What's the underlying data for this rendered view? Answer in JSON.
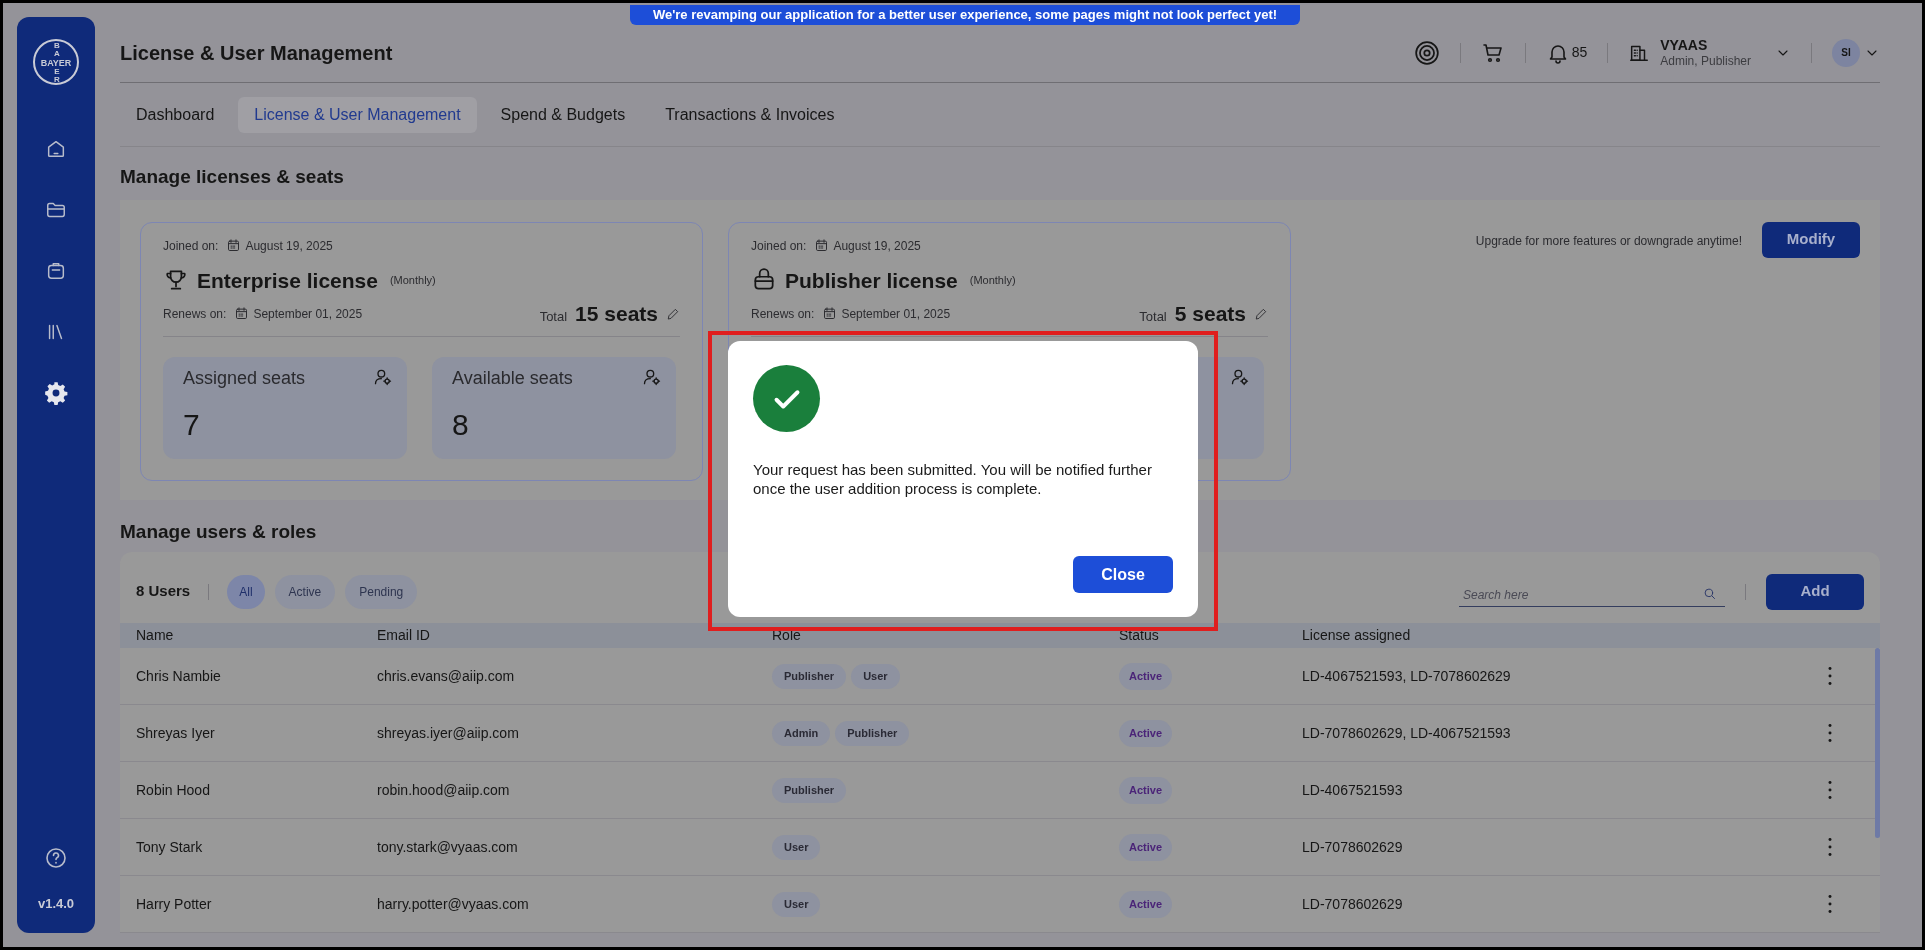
{
  "banner": "We're revamping our application for a better user experience, some pages might not look perfect yet!",
  "sidebar": {
    "logo": {
      "across": "BAYER",
      "down_top": "BA",
      "down_bottom": "ER"
    },
    "nav": [
      {
        "selected": false
      },
      {
        "selected": false
      },
      {
        "selected": false
      },
      {
        "selected": false
      },
      {
        "selected": true
      }
    ],
    "version": "v1.4.0"
  },
  "header": {
    "title": "License & User Management",
    "notification_count": "85",
    "org": {
      "name": "VYAAS",
      "roles": "Admin, Publisher"
    },
    "avatar_initials": "SI"
  },
  "tabs": [
    {
      "label": "Dashboard",
      "selected": false
    },
    {
      "label": "License & User Management",
      "selected": true
    },
    {
      "label": "Spend & Budgets",
      "selected": false
    },
    {
      "label": "Transactions & Invoices",
      "selected": false
    }
  ],
  "licenses_section": {
    "title": "Manage licenses & seats",
    "upgrade_text": "Upgrade for more features or downgrade anytime!",
    "modify_button": "Modify",
    "cards": [
      {
        "kind": "enterprise",
        "joined_label": "Joined on:",
        "joined_date": "August 19, 2025",
        "name": "Enterprise license",
        "period": "(Monthly)",
        "renews_label": "Renews on:",
        "renews_date": "September 01, 2025",
        "total_label": "Total",
        "total": "15 seats",
        "tiles": [
          {
            "label": "Assigned seats",
            "value": "7"
          },
          {
            "label": "Available seats",
            "value": "8"
          }
        ]
      },
      {
        "kind": "publisher",
        "joined_label": "Joined on:",
        "joined_date": "August 19, 2025",
        "name": "Publisher license",
        "period": "(Monthly)",
        "renews_label": "Renews on:",
        "renews_date": "September 01, 2025",
        "total_label": "Total",
        "total": "5 seats"
      }
    ]
  },
  "users_section": {
    "title": "Manage users & roles",
    "count": "8 Users",
    "filters": [
      {
        "label": "All",
        "selected": true
      },
      {
        "label": "Active",
        "selected": false
      },
      {
        "label": "Pending",
        "selected": false
      }
    ],
    "search": {
      "placeholder": "Search here"
    },
    "add_button": "Add",
    "columns": [
      "Name",
      "Email ID",
      "Role",
      "Status",
      "License assigned"
    ],
    "rows": [
      {
        "name": "Chris Nambie",
        "email": "chris.evans@aiip.com",
        "roles": [
          "Publisher",
          "User"
        ],
        "status": "Active",
        "license": "LD-4067521593, LD-7078602629"
      },
      {
        "name": "Shreyas Iyer",
        "email": "shreyas.iyer@aiip.com",
        "roles": [
          "Admin",
          "Publisher"
        ],
        "status": "Active",
        "license": "LD-7078602629, LD-4067521593"
      },
      {
        "name": "Robin Hood",
        "email": "robin.hood@aiip.com",
        "roles": [
          "Publisher"
        ],
        "status": "Active",
        "license": "LD-4067521593"
      },
      {
        "name": "Tony Stark",
        "email": "tony.stark@vyaas.com",
        "roles": [
          "User"
        ],
        "status": "Active",
        "license": "LD-7078602629"
      },
      {
        "name": "Harry Potter",
        "email": "harry.potter@vyaas.com",
        "roles": [
          "User"
        ],
        "status": "Active",
        "license": "LD-7078602629"
      }
    ]
  },
  "dialog": {
    "message": "Your request has been submitted. You will be notified further once the user addition process is complete.",
    "close_button": "Close",
    "highlighted": true
  }
}
